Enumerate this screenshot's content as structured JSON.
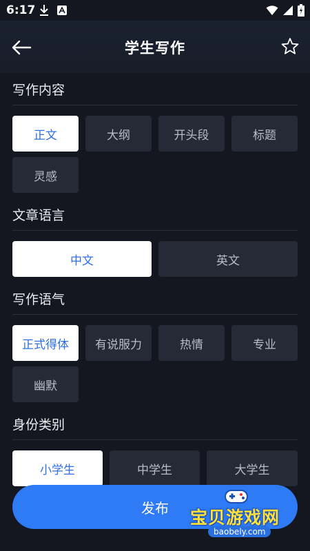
{
  "status_bar": {
    "time": "6:17"
  },
  "header": {
    "title": "学生写作"
  },
  "sections": [
    {
      "title": "写作内容",
      "options": [
        "正文",
        "大纲",
        "开头段",
        "标题",
        "灵感"
      ],
      "selected": "正文"
    },
    {
      "title": "文章语言",
      "options": [
        "中文",
        "英文"
      ],
      "selected": "中文"
    },
    {
      "title": "写作语气",
      "options": [
        "正式得体",
        "有说服力",
        "热情",
        "专业",
        "幽默"
      ],
      "selected": "正式得体"
    },
    {
      "title": "身份类别",
      "options": [
        "小学生",
        "中学生",
        "大学生"
      ],
      "selected": "小学生"
    }
  ],
  "publish_button": {
    "label": "发布"
  },
  "watermark": {
    "text": "宝贝游戏网",
    "url": "baobely.com"
  },
  "colors": {
    "accent": "#2f7af5",
    "selected_text": "#2f6fe6",
    "chip_bg": "#262a36",
    "background": "#14171f"
  }
}
